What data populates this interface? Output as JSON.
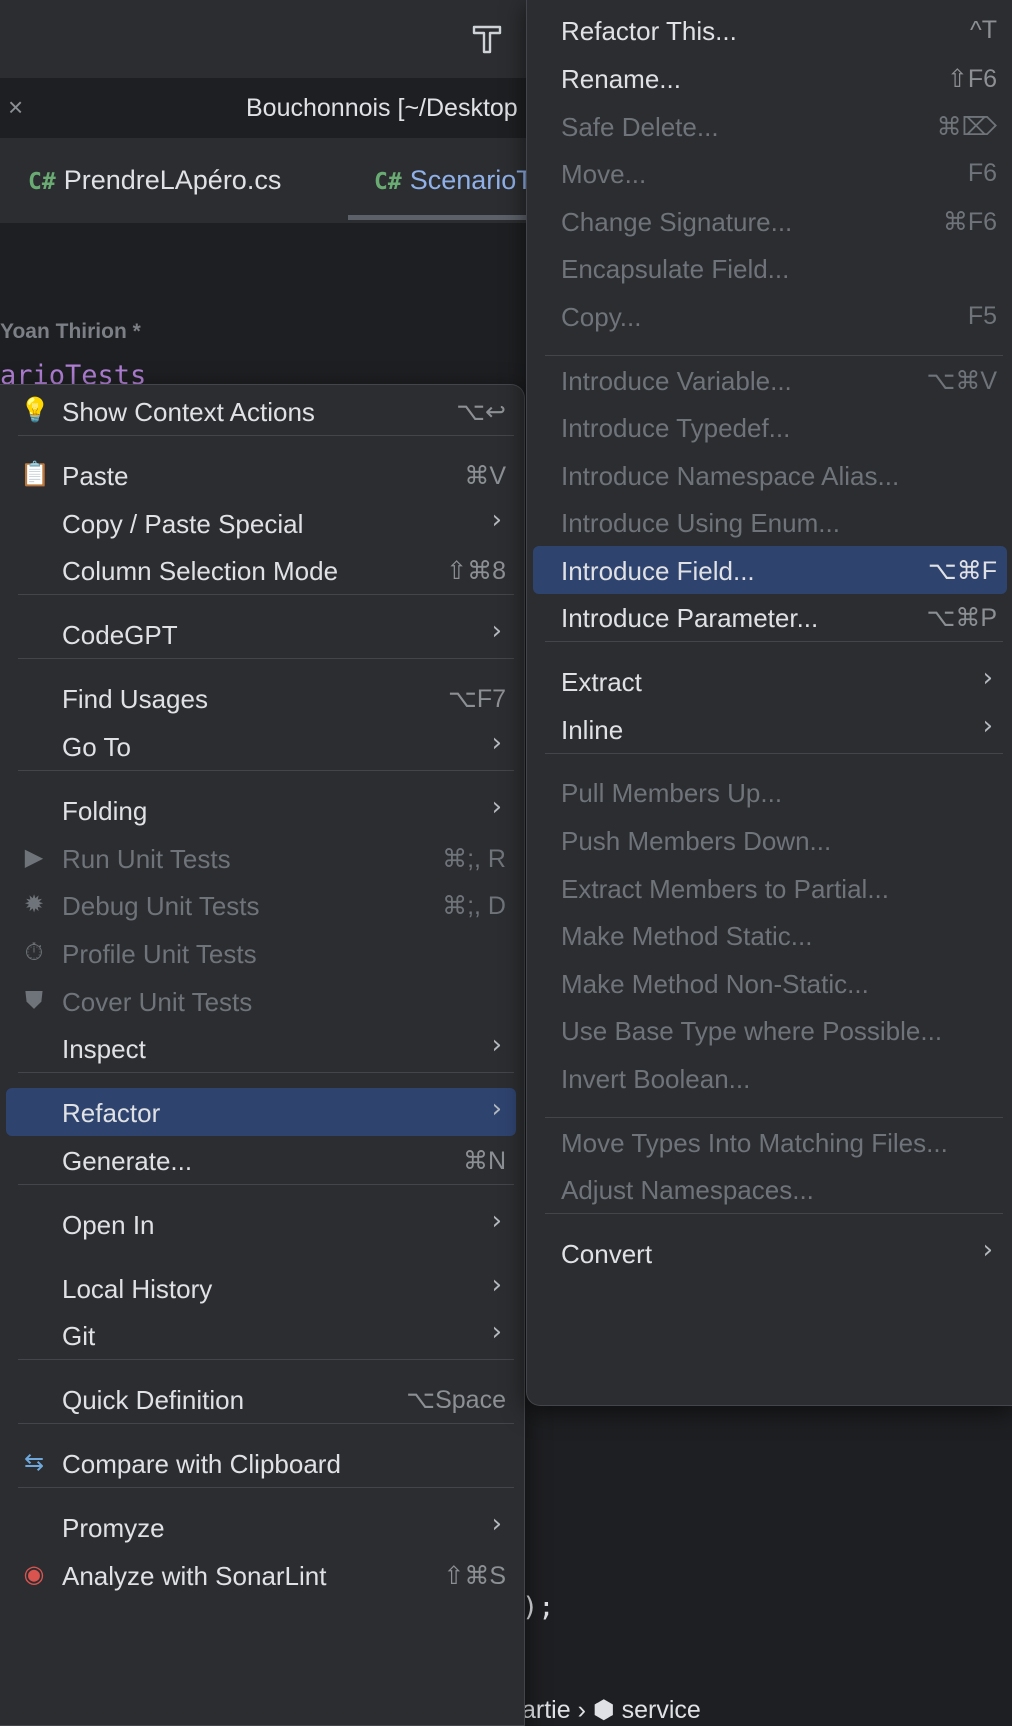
{
  "window": {
    "project_title": "Bouchonnois [~/Desktop",
    "close_glyph": "×"
  },
  "tabs": [
    {
      "lang": "C#",
      "label": "PrendreLApéro.cs"
    },
    {
      "lang": "C#",
      "label": "ScenarioT"
    }
  ],
  "editor": {
    "author": "Yoan Thirion *",
    "code_identifier": "arioTests",
    "code_tail": ");",
    "breadcrumb": "artie › ⬢ service"
  },
  "context_menu": {
    "items": [
      {
        "label": "Show Context Actions",
        "shortcut": "⌥↩",
        "icon": "lightbulb-icon",
        "glyph": "💡"
      },
      {
        "label": "Paste",
        "shortcut": "⌘V",
        "icon": "clipboard-icon",
        "glyph": "📋"
      },
      {
        "label": "Copy / Paste Special",
        "arrow": "›"
      },
      {
        "label": "Column Selection Mode",
        "shortcut": "⇧⌘8"
      },
      {
        "label": "CodeGPT",
        "arrow": "›"
      },
      {
        "label": "Find Usages",
        "shortcut": "⌥F7"
      },
      {
        "label": "Go To",
        "arrow": "›"
      },
      {
        "label": "Folding",
        "arrow": "›"
      },
      {
        "label": "Run Unit Tests",
        "shortcut": "⌘;, R",
        "icon": "play-icon",
        "glyph": "▶",
        "disabled": true
      },
      {
        "label": "Debug Unit Tests",
        "shortcut": "⌘;, D",
        "icon": "bug-icon",
        "glyph": "✹",
        "disabled": true
      },
      {
        "label": "Profile Unit Tests",
        "icon": "stopwatch-icon",
        "glyph": "⏱",
        "disabled": true
      },
      {
        "label": "Cover Unit Tests",
        "icon": "shield-icon",
        "glyph": "⛊",
        "disabled": true
      },
      {
        "label": "Inspect",
        "arrow": "›"
      },
      {
        "label": "Refactor",
        "arrow": "›",
        "selected": true
      },
      {
        "label": "Generate...",
        "shortcut": "⌘N"
      },
      {
        "label": "Open In",
        "arrow": "›"
      },
      {
        "label": "Local History",
        "arrow": "›"
      },
      {
        "label": "Git",
        "arrow": "›"
      },
      {
        "label": "Quick Definition",
        "shortcut": "⌥Space"
      },
      {
        "label": "Compare with Clipboard",
        "icon": "compare-clipboard-icon",
        "glyph": "⇆"
      },
      {
        "label": "Promyze",
        "arrow": "›"
      },
      {
        "label": "Analyze with SonarLint",
        "shortcut": "⇧⌘S",
        "icon": "sonarlint-icon",
        "glyph": "◉"
      }
    ]
  },
  "refactor_submenu": {
    "items": [
      {
        "label": "Refactor This...",
        "shortcut": "^T"
      },
      {
        "label": "Rename...",
        "shortcut": "⇧F6"
      },
      {
        "label": "Safe Delete...",
        "shortcut": "⌘⌦",
        "disabled": true
      },
      {
        "label": "Move...",
        "shortcut": "F6",
        "disabled": true
      },
      {
        "label": "Change Signature...",
        "shortcut": "⌘F6",
        "disabled": true
      },
      {
        "label": "Encapsulate Field...",
        "disabled": true
      },
      {
        "label": "Copy...",
        "shortcut": "F5",
        "disabled": true
      },
      {
        "label": "Introduce Variable...",
        "shortcut": "⌥⌘V",
        "disabled": true
      },
      {
        "label": "Introduce Typedef...",
        "disabled": true
      },
      {
        "label": "Introduce Namespace Alias...",
        "disabled": true
      },
      {
        "label": "Introduce Using Enum...",
        "disabled": true
      },
      {
        "label": "Introduce Field...",
        "shortcut": "⌥⌘F",
        "selected": true
      },
      {
        "label": "Introduce Parameter...",
        "shortcut": "⌥⌘P"
      },
      {
        "label": "Extract",
        "arrow": "›"
      },
      {
        "label": "Inline",
        "arrow": "›"
      },
      {
        "label": "Pull Members Up...",
        "disabled": true
      },
      {
        "label": "Push Members Down...",
        "disabled": true
      },
      {
        "label": "Extract Members to Partial...",
        "disabled": true
      },
      {
        "label": "Make Method Static...",
        "disabled": true
      },
      {
        "label": "Make Method Non-Static...",
        "disabled": true
      },
      {
        "label": "Use Base Type where Possible...",
        "disabled": true
      },
      {
        "label": "Invert Boolean...",
        "disabled": true
      },
      {
        "label": "Move Types Into Matching Files...",
        "disabled": true
      },
      {
        "label": "Adjust Namespaces...",
        "disabled": true
      },
      {
        "label": "Convert",
        "arrow": "›"
      }
    ]
  },
  "colors": {
    "selection": "#2e436e",
    "menu_bg": "#2b2d30",
    "disabled_text": "#6f737a"
  }
}
